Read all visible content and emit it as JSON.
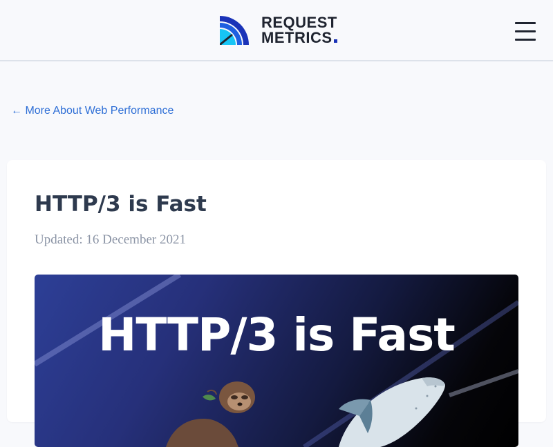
{
  "header": {
    "logo": {
      "line1": "REQUEST",
      "line2": "METRICS",
      "accent_color": "#1a33b8",
      "mark_colors": [
        "#1a33b8",
        "#1e5fe0",
        "#17c5f5"
      ]
    },
    "menu_icon": "hamburger-menu-icon"
  },
  "nav": {
    "back_link": "← More About Web Performance",
    "link_color": "#2f6fd6"
  },
  "article": {
    "title": "HTTP/3 is Fast",
    "updated": "Updated: 16 December 2021",
    "hero": {
      "headline": "HTTP/3 is Fast",
      "illustration": [
        "sloth-illustration",
        "rocket-illustration"
      ],
      "colors": [
        "#2d3f96",
        "#000000"
      ]
    }
  }
}
